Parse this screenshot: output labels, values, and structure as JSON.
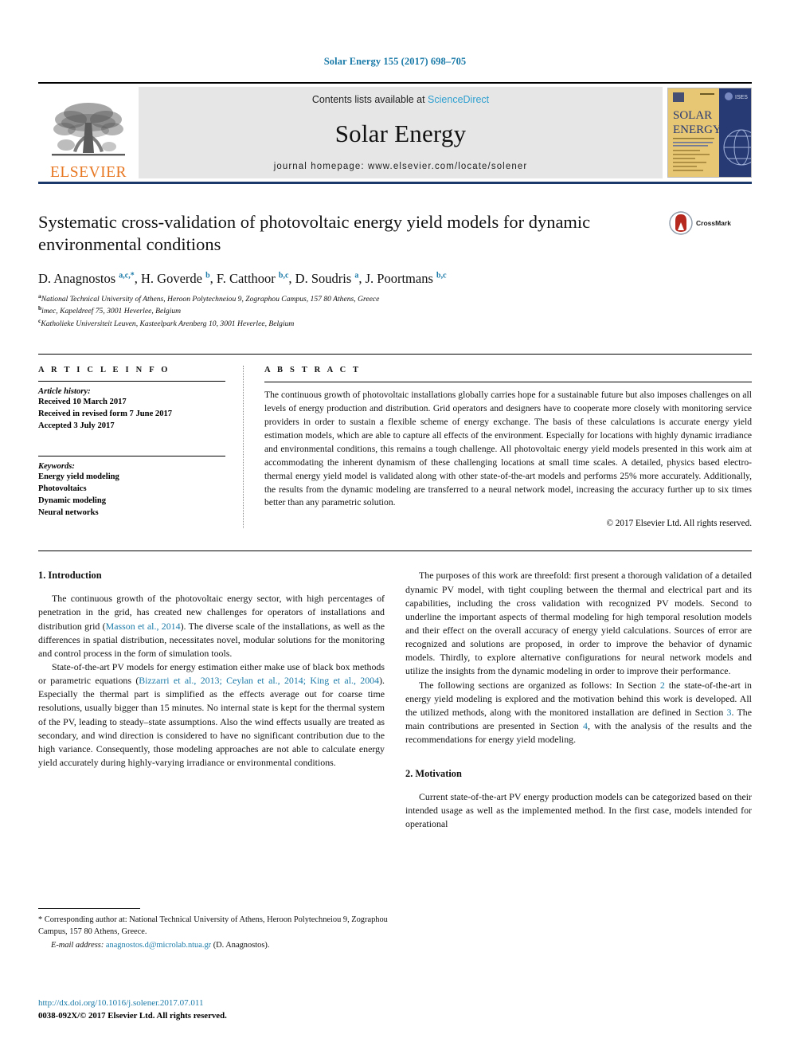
{
  "running_head": "Solar Energy 155 (2017) 698–705",
  "masthead": {
    "publisher_name": "ELSEVIER",
    "contents_prefix": "Contents lists available at ",
    "sciencedirect": "ScienceDirect",
    "journal_name": "Solar Energy",
    "homepage": "journal homepage: www.elsevier.com/locate/solener",
    "cover_title_line1": "SOLAR",
    "cover_title_line2": "ENERGY"
  },
  "article": {
    "title": "Systematic cross-validation of photovoltaic energy yield models for dynamic environmental conditions",
    "crossmark_label": "CrossMark",
    "authors_html": "D. Anagnostos <sup>a,c,</sup><sup>*</sup>, H. Goverde <sup>b</sup>, F. Catthoor <sup>b,c</sup>, D. Soudris <sup>a</sup>, J. Poortmans <sup>b,c</sup>",
    "affiliations": [
      {
        "marker": "a",
        "text": "National Technical University of Athens, Heroon Polytechneiou 9, Zographou Campus, 157 80 Athens, Greece"
      },
      {
        "marker": "b",
        "text": "imec, Kapeldreef 75, 3001 Heverlee, Belgium"
      },
      {
        "marker": "c",
        "text": "Katholieke Universiteit Leuven, Kasteelpark Arenberg 10, 3001 Heverlee, Belgium"
      }
    ]
  },
  "article_info": {
    "heading": "A R T I C L E   I N F O",
    "history_label": "Article history:",
    "history": [
      "Received 10 March 2017",
      "Received in revised form 7 June 2017",
      "Accepted 3 July 2017"
    ],
    "keywords_label": "Keywords:",
    "keywords": [
      "Energy yield modeling",
      "Photovoltaics",
      "Dynamic modeling",
      "Neural networks"
    ]
  },
  "abstract": {
    "heading": "A B S T R A C T",
    "text": "The continuous growth of photovoltaic installations globally carries hope for a sustainable future but also imposes challenges on all levels of energy production and distribution. Grid operators and designers have to cooperate more closely with monitoring service providers in order to sustain a flexible scheme of energy exchange. The basis of these calculations is accurate energy yield estimation models, which are able to capture all effects of the environment. Especially for locations with highly dynamic irradiance and environmental conditions, this remains a tough challenge. All photovoltaic energy yield models presented in this work aim at accommodating the inherent dynamism of these challenging locations at small time scales. A detailed, physics based electro-thermal energy yield model is validated along with other state-of-the-art models and performs 25% more accurately. Additionally, the results from the dynamic modeling are transferred to a neural network model, increasing the accuracy further up to six times better than any parametric solution.",
    "copyright": "© 2017 Elsevier Ltd. All rights reserved."
  },
  "body": {
    "left_column": {
      "section_title": "1. Introduction",
      "paragraph1_pre": "The continuous growth of the photovoltaic energy sector, with high percentages of penetration in the grid, has created new challenges for operators of installations and distribution grid (",
      "paragraph1_cite": "Masson et al., 2014",
      "paragraph1_post": "). The diverse scale of the installations, as well as the differences in spatial distribution, necessitates novel, modular solutions for the monitoring and control process in the form of simulation tools.",
      "paragraph2_pre": "State-of-the-art PV models for energy estimation either make use of black box methods or parametric equations (",
      "paragraph2_cite": "Bizzarri et al., 2013; Ceylan et al., 2014; King et al., 2004",
      "paragraph2_post": "). Especially the thermal part is simplified as the effects average out for coarse time resolutions, usually bigger than 15 minutes. No internal state is kept for the thermal system of the PV, leading to steady–state assumptions. Also the wind effects usually are treated as secondary, and wind direction is considered to have no significant contribution due to the high variance. Consequently, those modeling approaches are not able to calculate energy yield accurately during highly-varying irradiance or environmental conditions."
    },
    "right_column": {
      "paragraph1": "The purposes of this work are threefold: first present a thorough validation of a detailed dynamic PV model, with tight coupling between the thermal and electrical part and its capabilities, including the cross validation with recognized PV models. Second to underline the important aspects of thermal modeling for high temporal resolution models and their effect on the overall accuracy of energy yield calculations. Sources of error are recognized and solutions are proposed, in order to improve the behavior of dynamic models. Thirdly, to explore alternative configurations for neural network models and utilize the insights from the dynamic modeling in order to improve their performance.",
      "paragraph2_part1": "The following sections are organized as follows: In Section ",
      "paragraph2_link1": "2",
      "paragraph2_part2": " the state-of-the-art in energy yield modeling is explored and the motivation behind this work is developed. All the utilized methods, along with the monitored installation are defined in Section ",
      "paragraph2_link2": "3",
      "paragraph2_part3": ". The main contributions are presented in Section ",
      "paragraph2_link3": "4",
      "paragraph2_part4": ", with the analysis of the results and the recommendations for energy yield modeling.",
      "section_title": "2. Motivation",
      "paragraph3": "Current state-of-the-art PV energy production models can be categorized based on their intended usage as well as the implemented method. In the first case, models intended for operational"
    }
  },
  "footnote": {
    "corresponding": "* Corresponding author at: National Technical University of Athens, Heroon Polytechneiou 9, Zographou Campus, 157 80 Athens, Greece.",
    "email_label": "E-mail address:",
    "email": "anagnostos.d@microlab.ntua.gr",
    "email_suffix": "(D. Anagnostos)."
  },
  "footer": {
    "doi": "http://dx.doi.org/10.1016/j.solener.2017.07.011",
    "issn": "0038-092X/© 2017 Elsevier Ltd. All rights reserved."
  },
  "colors": {
    "link_blue": "#1a7aa8",
    "sciencedirect_blue": "#2e9fd0",
    "elsevier_orange": "#E87722",
    "cover_navy": "#283a73",
    "cover_tan": "#e8c774",
    "crossmark_red": "#b5291f"
  }
}
